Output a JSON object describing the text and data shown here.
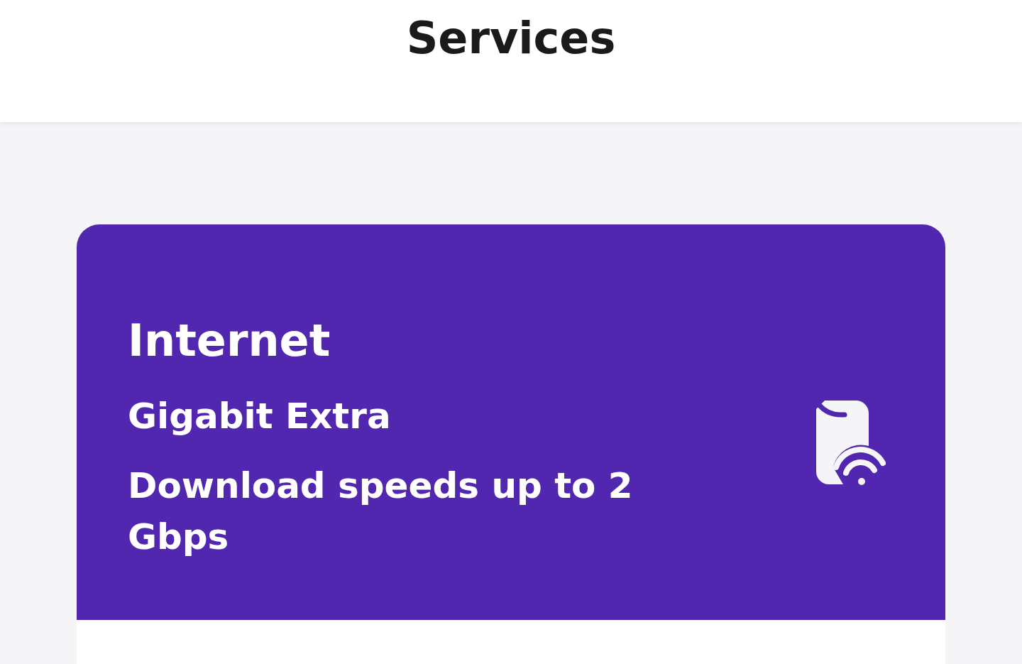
{
  "header": {
    "title": "Services"
  },
  "service_card": {
    "title": "Internet",
    "plan": "Gigabit Extra",
    "description": "Download speeds up to 2 Gbps"
  }
}
